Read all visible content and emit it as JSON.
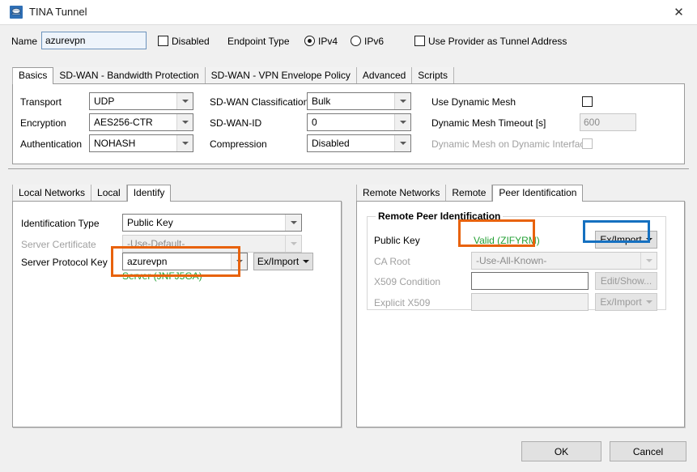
{
  "window": {
    "title": "TINA Tunnel",
    "icon": "tunnel-icon",
    "close_label": "✕"
  },
  "header": {
    "name_label": "Name",
    "name_value": "azurevpn",
    "name_placeholder": "",
    "disabled_label": "Disabled",
    "endpoint_type_label": "Endpoint Type",
    "ipv4_label": "IPv4",
    "ipv6_label": "IPv6",
    "use_provider_label": "Use Provider as Tunnel Address"
  },
  "main_tabs": [
    {
      "label": "Basics",
      "active": true
    },
    {
      "label": "SD-WAN - Bandwidth Protection",
      "active": false
    },
    {
      "label": "SD-WAN - VPN Envelope Policy",
      "active": false
    },
    {
      "label": "Advanced",
      "active": false
    },
    {
      "label": "Scripts",
      "active": false
    }
  ],
  "basics": {
    "col1": [
      {
        "label": "Transport",
        "value": "UDP"
      },
      {
        "label": "Encryption",
        "value": "AES256-CTR"
      },
      {
        "label": "Authentication",
        "value": "NOHASH"
      }
    ],
    "col2": [
      {
        "label": "SD-WAN Classification",
        "value": "Bulk"
      },
      {
        "label": "SD-WAN-ID",
        "value": "0"
      },
      {
        "label": "Compression",
        "value": "Disabled"
      }
    ],
    "col3": {
      "use_dynamic_mesh_label": "Use Dynamic Mesh",
      "dynamic_mesh_timeout_label": "Dynamic Mesh Timeout [s]",
      "dynamic_mesh_timeout_value": "600",
      "dynamic_mesh_on_dynamic_interface_label": "Dynamic Mesh on Dynamic Interface"
    }
  },
  "left_panel": {
    "tabs": [
      {
        "label": "Local Networks",
        "active": false
      },
      {
        "label": "Local",
        "active": false
      },
      {
        "label": "Identify",
        "active": true
      }
    ],
    "fields": [
      {
        "label": "Identification Type",
        "value": "Public Key",
        "disabled": false
      },
      {
        "label": "Server Certificate",
        "value": "-Use-Default-",
        "disabled": true
      },
      {
        "label": "Server Protocol Key",
        "value": "azurevpn",
        "disabled": false
      }
    ],
    "ex_import_label": "Ex/Import",
    "status_text": "Server (JNFJ5GA)"
  },
  "right_panel": {
    "tabs": [
      {
        "label": "Remote Networks",
        "active": false
      },
      {
        "label": "Remote",
        "active": false
      },
      {
        "label": "Peer Identification",
        "active": true
      }
    ],
    "group_title": "Remote Peer Identification",
    "public_key_label": "Public Key",
    "public_key_status": "Valid (ZIFYRM)",
    "public_key_ex_import_label": "Ex/Import",
    "ca_root_label": "CA Root",
    "ca_root_value": "-Use-All-Known-",
    "x509_condition_label": "X509 Condition",
    "x509_condition_value": "",
    "edit_show_label": "Edit/Show...",
    "explicit_x509_label": "Explicit X509",
    "explicit_x509_value": "",
    "explicit_x509_ex_import_label": "Ex/Import"
  },
  "footer": {
    "ok_label": "OK",
    "cancel_label": "Cancel"
  },
  "colors": {
    "highlight_orange": "#e8620c",
    "highlight_blue": "#1570c0",
    "status_green": "#22a033",
    "title_icon_blue": "#2f6fb5"
  }
}
